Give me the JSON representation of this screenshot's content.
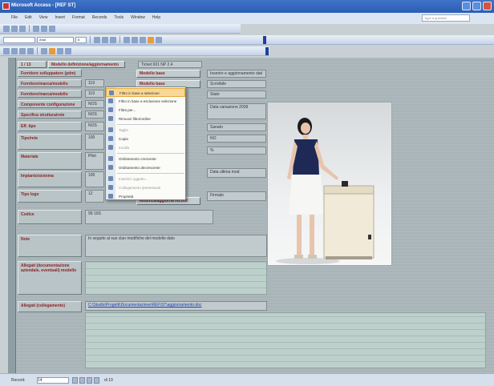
{
  "window": {
    "title": "Microsoft Access - [REF ST]"
  },
  "menu": [
    "File",
    "Edit",
    "View",
    "Insert",
    "Format",
    "Records",
    "Tools",
    "Window",
    "Help"
  ],
  "help_placeholder": "Type a question",
  "toolbar": {
    "font_combo": "Arial",
    "size_combo": "8"
  },
  "tabs": {
    "tab1": "1 / 13",
    "tab2": "Modello definizione/aggiornamento"
  },
  "header_value": "Ticket 001 NP 2.4",
  "fields": [
    {
      "label": "Fornitore sviluppatore (pdm)"
    },
    {
      "label": "Fornitore/marca/modello",
      "value": "119",
      "button": "Modello base"
    },
    {
      "label": "Fornitore/marca/modello",
      "value": "119",
      "button": "Modello base"
    },
    {
      "label": "Componente configurazione",
      "value": "NOS"
    },
    {
      "label": "Specifica struttura/rete",
      "value": "NOS"
    },
    {
      "label": "Eff. tipo",
      "value": "NOS"
    },
    {
      "label": "Tipo/rete",
      "value": "100"
    },
    {
      "label": "Materiale",
      "value": "Pilot"
    },
    {
      "label": "Impianto/sistema",
      "value": "100"
    },
    {
      "label": "Tipo logo",
      "value": "12"
    },
    {
      "label": "Codice",
      "value": "99 19S"
    },
    {
      "label": "Note",
      "value": "In seguito al suo clan modifiche del modello dato"
    },
    {
      "label": "Allegati (documentazione aziendale, eventuali) modello"
    },
    {
      "label": "Allegati (collegamento)",
      "value": "C:\\Studio\\Progetti\\Documentazione\\REF\\ST\\aggiornamento.doc"
    }
  ],
  "right_values": [
    "Inserire e aggiornamento dati",
    "Scrivibile",
    "Stato",
    "Data variazione 2009",
    "Sanato",
    "NO",
    "%",
    "Data ultima mod.",
    "Firmato"
  ],
  "update_button": "Modifica/aggiorna record",
  "dropdown": {
    "items": [
      {
        "label": "Filtro in base a selezione",
        "state": "highlight"
      },
      {
        "label": "Filtro in base a esclusione selezione",
        "state": "normal"
      },
      {
        "label": "Filtra per...",
        "state": "normal"
      },
      {
        "label": "Rimuovi filtro/ordine",
        "state": "normal"
      },
      {
        "label": "Taglia",
        "state": "disabled"
      },
      {
        "label": "Copia",
        "state": "normal"
      },
      {
        "label": "Incolla",
        "state": "disabled"
      },
      {
        "label": "Ordinamento crescente",
        "state": "normal"
      },
      {
        "label": "Ordinamento decrescente",
        "state": "normal"
      },
      {
        "label": "Inserisci oggetto...",
        "state": "disabled"
      },
      {
        "label": "Collegamento ipertestuale",
        "state": "disabled"
      },
      {
        "label": "Proprietà",
        "state": "normal"
      }
    ]
  },
  "status": {
    "record_label": "Record:",
    "record_value": "14",
    "of_total": "di 19"
  }
}
